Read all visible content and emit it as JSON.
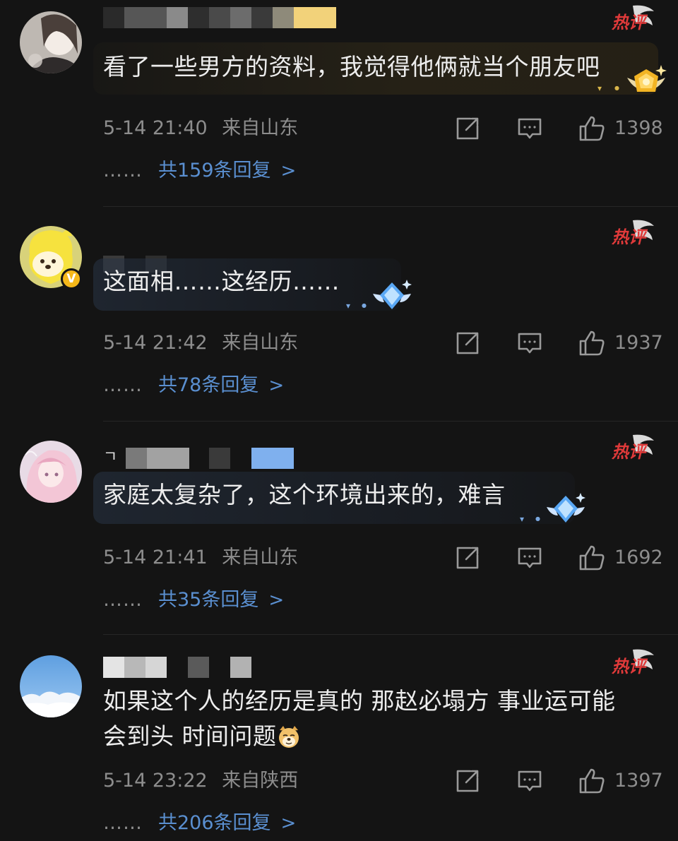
{
  "comments": [
    {
      "text": "看了一些男方的资料，我觉得他俩就当个朋友吧",
      "time": "5-14 21:40",
      "location": "来自山东",
      "likes": "1398",
      "replies": "共159条回复",
      "hot_label": "热评",
      "avatar": "portrait-girl"
    },
    {
      "text": "这面相……这经历……",
      "time": "5-14 21:42",
      "location": "来自山东",
      "likes": "1937",
      "replies": "共78条回复",
      "hot_label": "热评",
      "avatar": "yellow-cartoon",
      "verified_badge": "V"
    },
    {
      "text": "家庭太复杂了，这个环境出来的，难言",
      "time": "5-14 21:41",
      "location": "来自山东",
      "likes": "1692",
      "replies": "共35条回复",
      "hot_label": "热评",
      "avatar": "anime-pink",
      "name_prefix": "ㄱ"
    },
    {
      "text_line1": "如果这个人的经历是真的 那赵必塌方 事业运可能",
      "text_line2": "会到头 时间问题",
      "time": "5-14 23:22",
      "location": "来自陕西",
      "likes": "1397",
      "replies": "共206条回复",
      "hot_label": "热评",
      "avatar": "blue-sky",
      "emoji": "doge-icon"
    }
  ],
  "more_dots": "……",
  "colors": {
    "background": "#141414",
    "link": "#5a8fd0",
    "meta": "#8d8d8d",
    "hot_red": "#e03a3a"
  }
}
